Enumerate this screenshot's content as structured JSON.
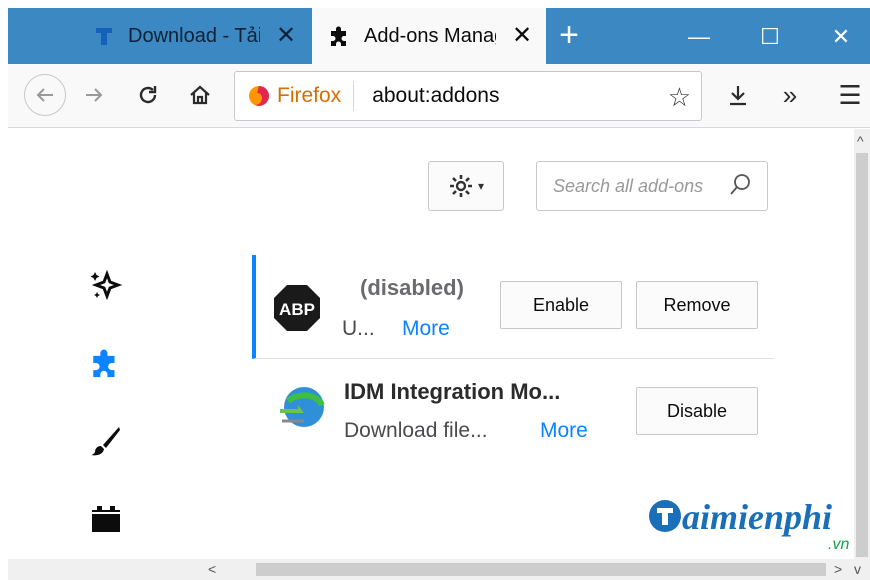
{
  "tabs": [
    {
      "title": "Download - Tải",
      "close": "✕"
    },
    {
      "title": "Add-ons Manag",
      "close": "✕"
    }
  ],
  "window_controls": {
    "new_tab": "+",
    "minimize": "—",
    "maximize": "☐",
    "close": "✕"
  },
  "navbar": {
    "identity_label": "Firefox",
    "url": "about:addons",
    "reload": "C",
    "overflow": "»",
    "menu": "☰"
  },
  "toolbar": {
    "gear_caret": "▾",
    "search_placeholder": "Search all add-ons"
  },
  "addons": [
    {
      "icon": "abp-icon",
      "name": "(disabled)",
      "desc": "U...",
      "more": "More",
      "buttons": [
        "Enable",
        "Remove"
      ]
    },
    {
      "icon": "idm-icon",
      "name": "IDM Integration Mo...",
      "desc": "Download file...",
      "more": "More",
      "buttons": [
        "Disable"
      ]
    }
  ],
  "sidebar": [
    "recommendations-icon",
    "extensions-icon",
    "themes-icon",
    "plugins-icon"
  ],
  "scroll": {
    "left": "<",
    "right": ">",
    "down": "v",
    "up": "^"
  },
  "watermark": {
    "main": "aimienphi",
    "sub": ".vn"
  },
  "colors": {
    "tabstrip": "#3b88c3",
    "accent": "#0a84ff",
    "firefox_label": "#d76e00"
  }
}
